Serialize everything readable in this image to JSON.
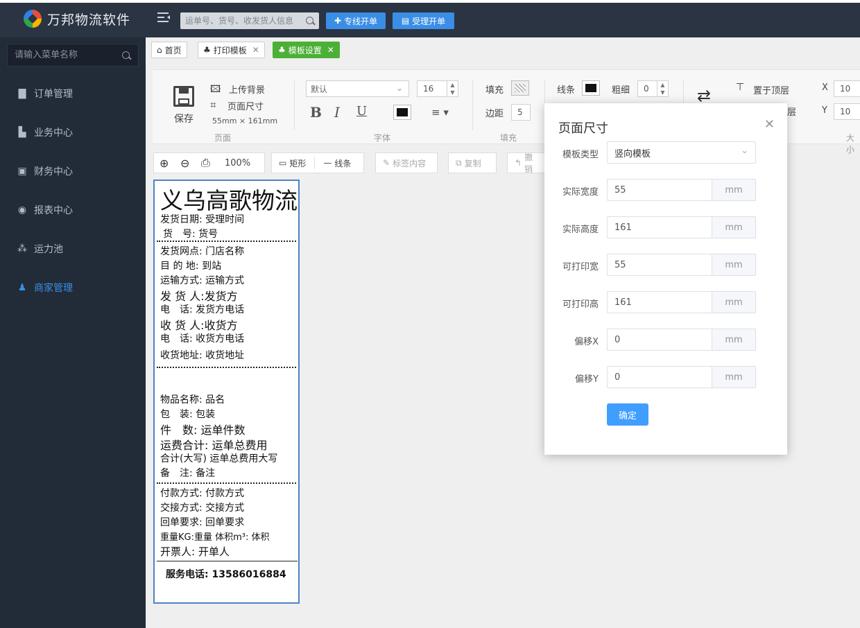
{
  "app": {
    "brand": "万邦物流软件",
    "search_placeholder": "运单号、货号、收发货人信息",
    "btn_line_order": "专线开单",
    "btn_accept_order": "受理开单"
  },
  "sidebar": {
    "search_placeholder": "请输入菜单名称",
    "items": [
      {
        "label": "订单管理"
      },
      {
        "label": "业务中心"
      },
      {
        "label": "财务中心"
      },
      {
        "label": "报表中心"
      },
      {
        "label": "运力池"
      },
      {
        "label": "商家管理"
      }
    ]
  },
  "tabs": [
    {
      "label": "首页"
    },
    {
      "label": "打印模板"
    },
    {
      "label": "模板设置"
    }
  ],
  "ribbon": {
    "save": "保存",
    "upload_bg": "上传背景",
    "page_size": "页面尺寸",
    "size_readout": "55mm × 161mm",
    "grp_page": "页面",
    "font_default": "默认",
    "font_size": "16",
    "bold": "B",
    "italic": "I",
    "underline": "U",
    "grp_font": "字体",
    "fill": "填充",
    "padding": "边距",
    "padding_val": "5",
    "grp_fill": "填充",
    "line": "线条",
    "thickness": "粗细",
    "thickness_val": "0",
    "to_top": "置于顶层",
    "to_bottom_partial": "层",
    "x_label": "X",
    "x_val": "10",
    "y_label": "Y",
    "y_val": "10",
    "grp_size_partial": "大小"
  },
  "toolbar2": {
    "zoom": "100%",
    "rect": "矩形",
    "line": "线条",
    "label_content": "标签内容",
    "copy": "复制",
    "undo_partial": "撤销"
  },
  "label": {
    "title": "义乌高歌物流",
    "l1": "发货日期: 受理时间",
    "l2": "货　号:  货号",
    "l3": "发货网点: 门店名称",
    "l4": "目 的 地:  到站",
    "l5": "运输方式: 运输方式",
    "l6": "发 货 人:发货方",
    "l7": " 电　话:  发货方电话",
    "l8": "收 货 人:收货方",
    "l9": " 电　话:  收货方电话",
    "l10": "收货地址: 收货地址",
    "l11": "物品名称:    品名",
    "l12": "包　装:      包装",
    "l13": "件　数:    运单件数",
    "l14": "运费合计:  运单总费用",
    "l15": "合计(大写) 运单总费用大写",
    "l16": "备　注: 备注",
    "l17": "付款方式:  付款方式",
    "l18": "交接方式:  交接方式",
    "l19": "回单要求:  回单要求",
    "l20": "重量KG:重量    体积m³: 体积",
    "l21": "开票人:     开单人",
    "l22": "服务电话: 13586016884"
  },
  "dialog": {
    "title": "页面尺寸",
    "template_type_label": "模板类型",
    "template_type": "竖向模板",
    "fields": [
      {
        "label": "实际宽度",
        "value": "55",
        "unit": "mm"
      },
      {
        "label": "实际高度",
        "value": "161",
        "unit": "mm"
      },
      {
        "label": "可打印宽",
        "value": "55",
        "unit": "mm"
      },
      {
        "label": "可打印高",
        "value": "161",
        "unit": "mm"
      },
      {
        "label": "偏移X",
        "value": "0",
        "unit": "mm"
      },
      {
        "label": "偏移Y",
        "value": "0",
        "unit": "mm"
      }
    ],
    "confirm": "确定"
  }
}
